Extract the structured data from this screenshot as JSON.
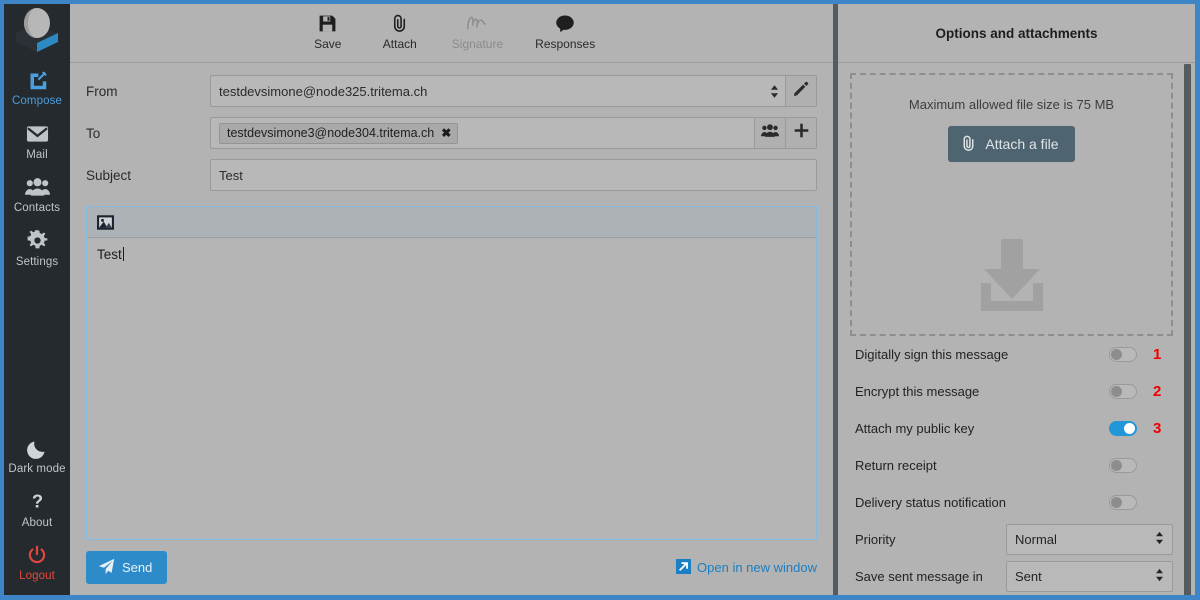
{
  "sidebar": {
    "logo_name": "app-logo",
    "top_items": [
      {
        "label": "Compose",
        "icon": "compose-pencil-icon",
        "active": true
      },
      {
        "label": "Mail",
        "icon": "envelope-icon",
        "active": false
      },
      {
        "label": "Contacts",
        "icon": "contacts-people-icon",
        "active": false
      },
      {
        "label": "Settings",
        "icon": "gear-icon",
        "active": false
      }
    ],
    "bottom_items": [
      {
        "label": "Dark mode",
        "icon": "moon-icon",
        "danger": false
      },
      {
        "label": "About",
        "icon": "question-mark-icon",
        "danger": false
      },
      {
        "label": "Logout",
        "icon": "power-icon",
        "danger": true
      }
    ]
  },
  "toolbar": {
    "buttons": [
      {
        "label": "Save",
        "icon": "floppy-disk-icon",
        "disabled": false
      },
      {
        "label": "Attach",
        "icon": "paperclip-icon",
        "disabled": false
      },
      {
        "label": "Signature",
        "icon": "signature-script-icon",
        "disabled": true
      },
      {
        "label": "Responses",
        "icon": "speech-bubble-icon",
        "disabled": false
      }
    ]
  },
  "compose": {
    "from": {
      "label": "From",
      "value": "testdevsimone@node325.tritema.ch"
    },
    "to": {
      "label": "To",
      "recipients": [
        "testdevsimone3@node304.tritema.ch"
      ],
      "chip_remove": "✖"
    },
    "subject": {
      "label": "Subject",
      "value": "Test"
    },
    "body": {
      "value": "Test"
    },
    "send_label": "Send",
    "open_new_window_label": "Open in new window"
  },
  "options": {
    "header": "Options and attachments",
    "dropzone": {
      "max_size_text": "Maximum allowed file size is 75 MB",
      "attach_button_label": "Attach a file"
    },
    "toggles": [
      {
        "label": "Digitally sign this message",
        "on": false,
        "annotation": "1"
      },
      {
        "label": "Encrypt this message",
        "on": false,
        "annotation": "2"
      },
      {
        "label": "Attach my public key",
        "on": true,
        "annotation": "3"
      },
      {
        "label": "Return receipt",
        "on": false,
        "annotation": ""
      },
      {
        "label": "Delivery status notification",
        "on": false,
        "annotation": ""
      }
    ],
    "selects": [
      {
        "label": "Priority",
        "value": "Normal"
      },
      {
        "label": "Save sent message in",
        "value": "Sent"
      }
    ]
  },
  "colors": {
    "accent_blue": "#3d85c6",
    "toggle_on": "#2196d8",
    "annotation_red": "#ee0000",
    "sidebar_bg": "#252a2e",
    "logout_red": "#e2483c",
    "page_bg": "#b3b3b3"
  }
}
